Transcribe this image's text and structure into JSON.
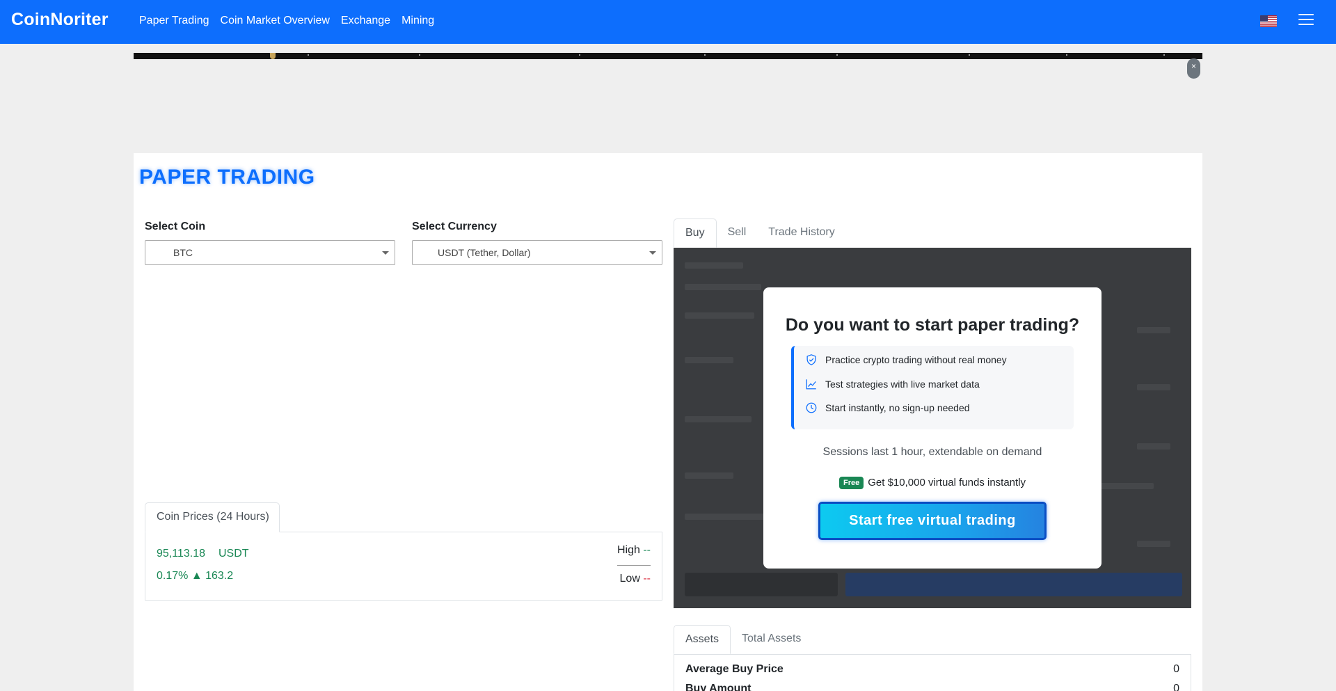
{
  "navbar": {
    "brand": "CoinNoriter",
    "links": [
      "Paper Trading",
      "Coin Market Overview",
      "Exchange",
      "Mining"
    ],
    "flag_icon": "us-flag-icon",
    "menu_icon": "hamburger-menu-icon",
    "bg_color": "#0d6efd"
  },
  "ad": {
    "close_label": "×"
  },
  "page": {
    "title": "PAPER TRADING"
  },
  "coin_select": {
    "label": "Select Coin",
    "value": "BTC"
  },
  "currency_select": {
    "label": "Select Currency",
    "value": "USDT (Tether, Dollar)"
  },
  "prices": {
    "tab_label": "Coin Prices (24 Hours)",
    "price": "95,113.18",
    "currency": "USDT",
    "change": "0.17% ▲ 163.2",
    "high_label": "High",
    "high_value": "--",
    "low_label": "Low",
    "low_value": "--",
    "up_color": "#198754",
    "down_color": "#dc3545"
  },
  "trade_tabs": {
    "items": [
      "Buy",
      "Sell",
      "Trade History"
    ],
    "active": "Buy"
  },
  "modal": {
    "title": "Do you want to start paper trading?",
    "features": [
      {
        "icon": "shield-check-icon",
        "text": "Practice crypto trading without real money"
      },
      {
        "icon": "line-chart-icon",
        "text": "Test strategies with live market data"
      },
      {
        "icon": "clock-icon",
        "text": "Start instantly, no sign-up needed"
      }
    ],
    "session_note": "Sessions last 1 hour, extendable on demand",
    "badge": "Free",
    "free_text": "Get $10,000 virtual funds instantly",
    "cta_label": "Start free virtual trading"
  },
  "asset_tabs": {
    "items": [
      "Assets",
      "Total Assets"
    ],
    "active": "Assets"
  },
  "assets": {
    "rows": [
      {
        "label": "Average Buy Price",
        "value": "0"
      },
      {
        "label": "Buy Amount",
        "value": "0"
      }
    ]
  }
}
